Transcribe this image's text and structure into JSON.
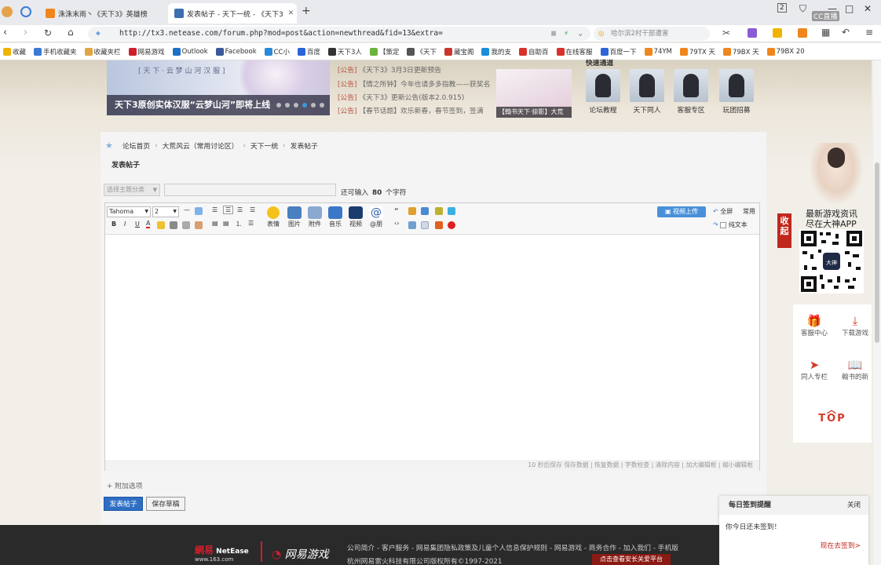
{
  "browser": {
    "tabs": [
      {
        "label": "洙洙末雨丶《天下3》英雄榜",
        "active": false,
        "color": "#f0861b"
      },
      {
        "label": "发表帖子 - 天下一统 - 《天下3",
        "active": true,
        "color": "#3c6fb0"
      }
    ],
    "new_tab": "+",
    "url": "http://tx3.netease.com/forum.php?mod=post&action=newthread&fid=13&extra=",
    "search_placeholder": "哈尔滨2村干部遭害",
    "window_controls": [
      "2",
      "—",
      "□",
      "✕"
    ],
    "cc_badge": "CC直播"
  },
  "bookmarks": [
    {
      "label": "收藏",
      "color": "#f0b400"
    },
    {
      "label": "手机收藏夹",
      "color": "#3a7bd5"
    },
    {
      "label": "收藏夹栏",
      "color": "#e0a640"
    },
    {
      "label": "网易游戏",
      "color": "#d01f2b"
    },
    {
      "label": "Outlook",
      "color": "#1e6fc8"
    },
    {
      "label": "Facebook",
      "color": "#3b5998"
    },
    {
      "label": "CC小",
      "color": "#2a89d8"
    },
    {
      "label": "百度",
      "color": "#2d64d8"
    },
    {
      "label": "天下3人",
      "color": "#333"
    },
    {
      "label": "【策定",
      "color": "#6bb43c"
    },
    {
      "label": "《天下",
      "color": "#555"
    },
    {
      "label": "藏宝阁",
      "color": "#c8372d"
    },
    {
      "label": "我的支",
      "color": "#1a8fd8"
    },
    {
      "label": "自助百",
      "color": "#d8322a"
    },
    {
      "label": "在线客服",
      "color": "#d8322a"
    },
    {
      "label": "百度一下",
      "color": "#2d64d8"
    },
    {
      "label": "74YM",
      "color": "#f0861b"
    },
    {
      "label": "79TX 天",
      "color": "#f0861b"
    },
    {
      "label": "79BX 天",
      "color": "#f0861b"
    },
    {
      "label": "79BX 20",
      "color": "#f0861b"
    }
  ],
  "banner": {
    "top_text": "[ 天 下 · 云 梦 山 河 汉 服 ]",
    "caption": "天下3原创实体汉服“云梦山河”即将上线",
    "dots": 6,
    "active_dot": 4
  },
  "notices": [
    {
      "tag": "[公告]",
      "text": "《天下3》3月3日更新预告"
    },
    {
      "tag": "[公告]",
      "text": "【情之所钟】今年也请多多指教——获奖名"
    },
    {
      "tag": "[公告]",
      "text": "《天下3》更新公告(版本2.0.915)"
    },
    {
      "tag": "[公告]",
      "text": "【春节话题】欢乐新春，春节签到，签满"
    }
  ],
  "notice_image_caption": "【翰书天下·掠影】大荒",
  "quick_links": [
    "论坛教程",
    "天下同人",
    "客服专区",
    "玩团招募"
  ],
  "quick_links_title": "快速通道",
  "breadcrumb": [
    "论坛首页",
    "大荒风云（常用讨论区）",
    "天下一统",
    "发表帖子"
  ],
  "page_title": "发表帖子",
  "form": {
    "category_placeholder": "选择主题分类",
    "title_value": "",
    "char_hint_prefix": "还可输入",
    "char_hint_count": "80",
    "char_hint_suffix": "个字符"
  },
  "editor": {
    "font_name": "Tahoma",
    "font_size": "2",
    "tools_big": [
      "表情",
      "图片",
      "附件",
      "音乐",
      "视频",
      "@朋"
    ],
    "video_upload": "视频上传",
    "fullscreen": "全屏",
    "common": "常用",
    "plain_text": "纯文本",
    "bold": "B",
    "italic": "I",
    "underline": "U",
    "status": "10 秒后保存 保存数据 | 恢复数据 | 字数检查 | 清除内容 | 加大编辑框 | 缩小编辑框"
  },
  "extra_options": "附加选项",
  "buttons": {
    "submit": "发表帖子",
    "save_draft": "保存草稿"
  },
  "side": {
    "tab_label": "收起",
    "promo_line1": "最新游戏资讯",
    "promo_line2": "尽在大神APP",
    "qr_label": "大神",
    "items": [
      {
        "label": "客服中心",
        "icon": "🎁"
      },
      {
        "label": "下载游戏",
        "icon": "⤓"
      },
      {
        "label": "同人专栏",
        "icon": "➤"
      },
      {
        "label": "翰书的新",
        "icon": "📖"
      }
    ],
    "top_label": "TOP",
    "top_arrow": "︿"
  },
  "checkin": {
    "title": "每日签到提醒",
    "close": "关闭",
    "message": "你今日还未签到！",
    "link": "现在去签到>"
  },
  "footer": {
    "logo_main": "網易",
    "logo_en": "NetEase",
    "logo_sub": "www.163.com",
    "logo_game": "网易游戏",
    "links": "公司简介 - 客户服务 - 网易集团隐私政策及儿童个人信息保护规则 - 网易游戏 - 商务合作 - 加入我们 - 手机版",
    "copyright": "杭州网易雷火科技有限公司版权所有©1997-2021",
    "red_bar": "点击查看安长关爱平台"
  }
}
